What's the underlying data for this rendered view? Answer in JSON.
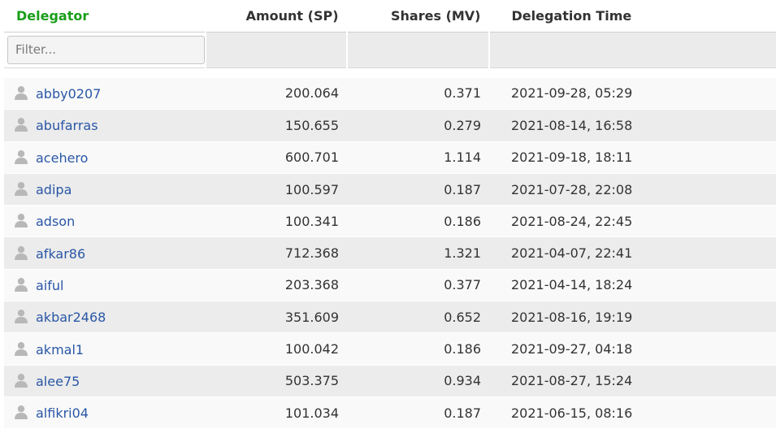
{
  "columns": {
    "delegator": "Delegator",
    "amount": "Amount (SP)",
    "shares": "Shares (MV)",
    "time": "Delegation Time"
  },
  "filter": {
    "placeholder": "Filter..."
  },
  "colors": {
    "sorted_header": "#1a9e1a",
    "link": "#2a57a6",
    "row_odd": "#f9f9f9",
    "row_even": "#ececec"
  },
  "icons": {
    "user": "user-icon"
  },
  "rows": [
    {
      "name": "abby0207",
      "amount": "200.064",
      "shares": "0.371",
      "time": "2021-09-28, 05:29"
    },
    {
      "name": "abufarras",
      "amount": "150.655",
      "shares": "0.279",
      "time": "2021-08-14, 16:58"
    },
    {
      "name": "acehero",
      "amount": "600.701",
      "shares": "1.114",
      "time": "2021-09-18, 18:11"
    },
    {
      "name": "adipa",
      "amount": "100.597",
      "shares": "0.187",
      "time": "2021-07-28, 22:08"
    },
    {
      "name": "adson",
      "amount": "100.341",
      "shares": "0.186",
      "time": "2021-08-24, 22:45"
    },
    {
      "name": "afkar86",
      "amount": "712.368",
      "shares": "1.321",
      "time": "2021-04-07, 22:41"
    },
    {
      "name": "aiful",
      "amount": "203.368",
      "shares": "0.377",
      "time": "2021-04-14, 18:24"
    },
    {
      "name": "akbar2468",
      "amount": "351.609",
      "shares": "0.652",
      "time": "2021-08-16, 19:19"
    },
    {
      "name": "akmal1",
      "amount": "100.042",
      "shares": "0.186",
      "time": "2021-09-27, 04:18"
    },
    {
      "name": "alee75",
      "amount": "503.375",
      "shares": "0.934",
      "time": "2021-08-27, 15:24"
    },
    {
      "name": "alfikri04",
      "amount": "101.034",
      "shares": "0.187",
      "time": "2021-06-15, 08:16"
    }
  ]
}
